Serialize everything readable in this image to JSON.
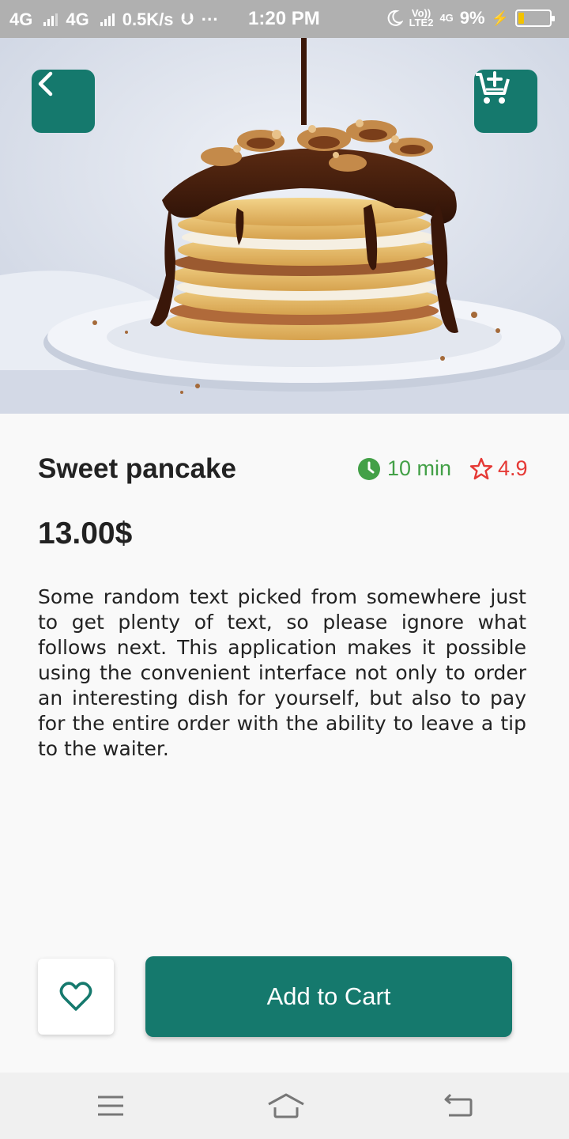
{
  "status_bar": {
    "network1": "4G",
    "network2": "4G",
    "speed": "0.5K/s",
    "usb_icon": "usb-icon",
    "more": "···",
    "time": "1:20 PM",
    "volte_top": "Vo))",
    "volte_bottom": "LTE2",
    "network3": "4G",
    "battery_percent": "9%",
    "battery_level": 0.09
  },
  "header": {
    "back_icon": "chevron-left-icon",
    "cart_icon": "add-shopping-cart-icon"
  },
  "product": {
    "name": "Sweet pancake",
    "time": "10 min",
    "rating": "4.9",
    "price": "13.00$",
    "description": "Some random text picked from somewhere just to get plenty of text, so please ignore what follows next. This application makes it possible using the convenient interface not only to order an interesting dish for yourself, but also to pay for the entire order with the ability to leave a tip to the waiter."
  },
  "actions": {
    "favorite_icon": "heart-outline-icon",
    "add_to_cart": "Add to Cart"
  },
  "nav": {
    "menu_icon": "menu-icon",
    "home_icon": "home-icon",
    "back_icon": "back-icon"
  },
  "colors": {
    "primary": "#15796d",
    "time_green": "#43a047",
    "rating_red": "#e53935"
  }
}
